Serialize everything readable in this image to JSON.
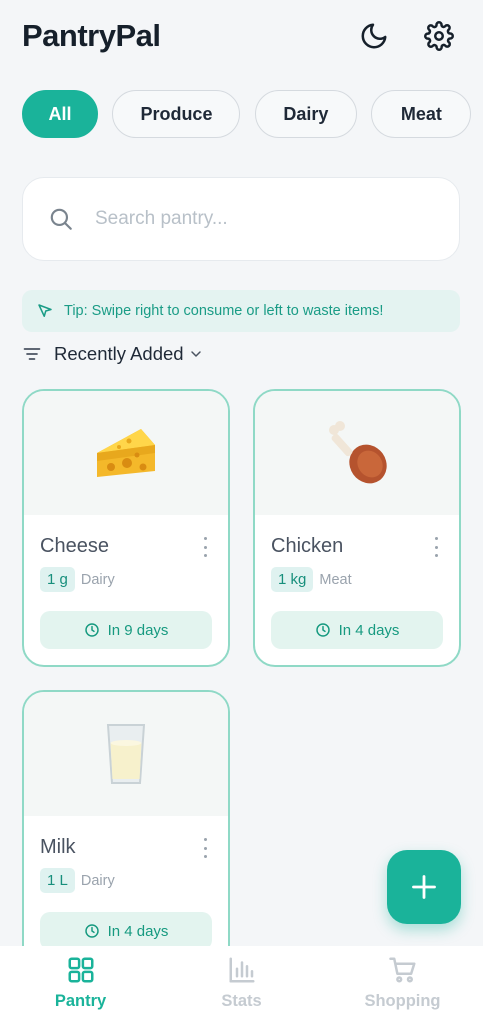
{
  "app": {
    "title": "PantryPal",
    "accent_color": "#1ab39a"
  },
  "header": {
    "theme_icon": "moon-icon",
    "settings_icon": "gear-icon"
  },
  "filters": [
    {
      "label": "All",
      "active": true
    },
    {
      "label": "Produce",
      "active": false
    },
    {
      "label": "Dairy",
      "active": false
    },
    {
      "label": "Meat",
      "active": false
    },
    {
      "label": "",
      "active": false
    }
  ],
  "search": {
    "placeholder": "Search pantry...",
    "value": ""
  },
  "tip": {
    "text": "Tip: Swipe right to consume or left to waste items!"
  },
  "sort": {
    "label": "Recently Added"
  },
  "items": [
    {
      "name": "Cheese",
      "quantity": "1 g",
      "category": "Dairy",
      "expiry": "In 9 days",
      "icon": "cheese-emoji"
    },
    {
      "name": "Chicken",
      "quantity": "1 kg",
      "category": "Meat",
      "expiry": "In 4 days",
      "icon": "chicken-leg-emoji"
    },
    {
      "name": "Milk",
      "quantity": "1 L",
      "category": "Dairy",
      "expiry": "In 4 days",
      "icon": "milk-glass-emoji"
    }
  ],
  "nav": [
    {
      "label": "Pantry",
      "icon": "grid-icon",
      "active": true
    },
    {
      "label": "Stats",
      "icon": "bar-chart-icon",
      "active": false
    },
    {
      "label": "Shopping",
      "icon": "cart-icon",
      "active": false
    }
  ]
}
